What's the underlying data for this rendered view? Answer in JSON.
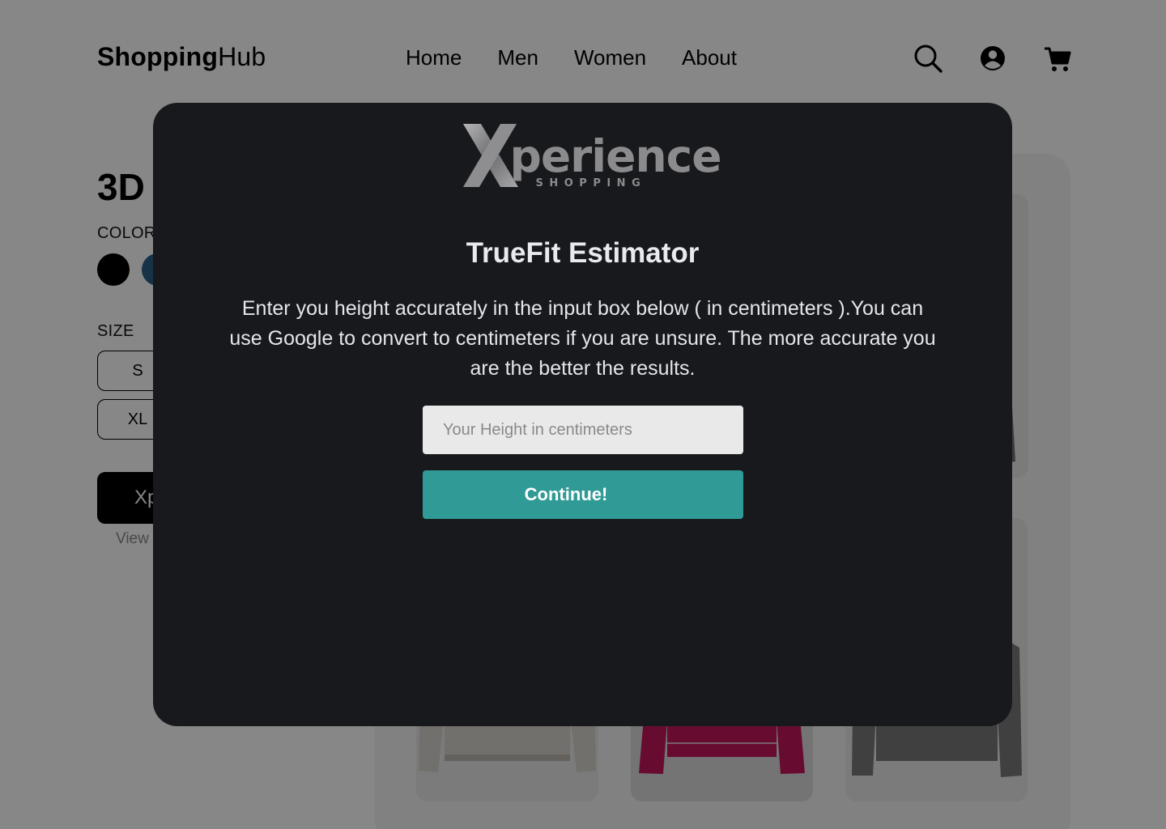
{
  "header": {
    "logo_bold": "Shopping",
    "logo_light": "Hub",
    "nav": [
      "Home",
      "Men",
      "Women",
      "About"
    ],
    "icons": [
      "search-icon",
      "account-icon",
      "cart-icon"
    ]
  },
  "product": {
    "title": "3D",
    "color_label": "COLOR",
    "colors": [
      "#000000",
      "#2b5f86"
    ],
    "size_label": "SIZE",
    "sizes": [
      "S",
      "XL"
    ],
    "xp_button_label": "Xp",
    "view_link": "View"
  },
  "modal": {
    "brand_word": "perience",
    "brand_sub": "SHOPPING",
    "title": "TrueFit Estimator",
    "description": "Enter you height accurately in the input box below ( in centimeters ).You can use Google to convert to centimeters if you are unsure. The more accurate you are the better the results.",
    "input_placeholder": "Your Height in centimeters",
    "input_value": "",
    "continue_label": "Continue!",
    "accent_color": "#2f9a96"
  }
}
